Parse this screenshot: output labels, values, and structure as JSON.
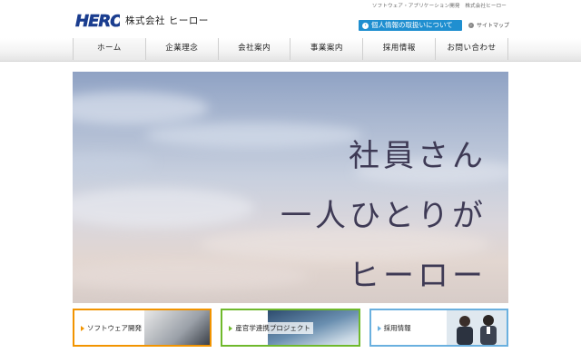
{
  "header": {
    "tagline": "ソフトウェア・アプリケーション開発　株式会社ヒーロー",
    "logo_text": "HERO",
    "company_name": "株式会社 ヒーロー",
    "privacy_link": "個人情報の取扱いについて",
    "sitemap_link": "サイトマップ"
  },
  "nav": {
    "items": [
      "ホーム",
      "企業理念",
      "会社案内",
      "事業案内",
      "採用情報",
      "お問い合わせ"
    ]
  },
  "hero": {
    "line1": "社員さん",
    "line2": "一人ひとりが",
    "line3": "ヒーロー"
  },
  "banners": [
    {
      "label": "ソフトウェア開発",
      "icon": "laptop-image"
    },
    {
      "label": "産官学連携プロジェクト",
      "icon": "night-sky-image"
    },
    {
      "label": "採用情報",
      "icon": "staff-photo-image"
    }
  ],
  "colors": {
    "accent_blue": "#1f8fd0",
    "logo_blue": "#1a3d8f",
    "banner_orange": "#f29400",
    "banner_green": "#6fb92c",
    "banner_lightblue": "#6ab0df"
  }
}
